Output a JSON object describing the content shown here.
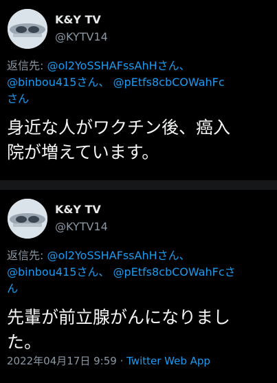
{
  "tweets": [
    {
      "name": "K&Y TV",
      "handle": "@KYTV14",
      "reply_prefix": "返信先: ",
      "mentions": [
        "@ol2YoSSHAFssAhHさん、",
        "@binbou415さん、",
        "@pEtfs8cbCOWahFc",
        "さん"
      ],
      "text_lines": [
        "身近な人がワクチン後、癌入",
        "院が増えています。"
      ]
    },
    {
      "name": "K&Y TV",
      "handle": "@KYTV14",
      "reply_prefix": "返信先: ",
      "mentions": [
        "@ol2YoSSHAFssAhHさん、",
        "@binbou415さん、",
        "@pEtfs8cbCOWahFcさ",
        "ん"
      ],
      "text_lines": [
        "先輩が前立腺がんになりまし",
        "た。"
      ],
      "date": "2022年04月17日 9:59",
      "separator": " · ",
      "app": "Twitter Web App"
    }
  ]
}
